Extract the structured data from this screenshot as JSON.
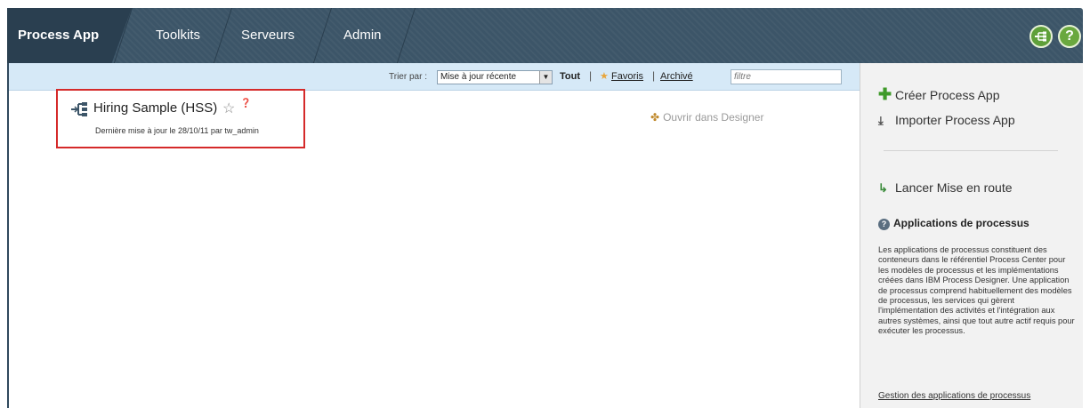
{
  "nav": {
    "tabs": [
      {
        "label": "Process App",
        "active": true
      },
      {
        "label": "Toolkits",
        "active": false
      },
      {
        "label": "Serveurs",
        "active": false
      },
      {
        "label": "Admin",
        "active": false
      }
    ],
    "icons": {
      "left": "network-icon",
      "right": "help-icon"
    },
    "help_glyph": "?"
  },
  "filterbar": {
    "sort_label": "Trier par :",
    "sort_value": "Mise à jour récente",
    "filters": {
      "all": "Tout",
      "favorites": "Favoris",
      "archived": "Archivé"
    },
    "separator": "|",
    "search_placeholder": "filtre"
  },
  "app": {
    "title": "Hiring Sample (HSS)",
    "updated": "Dernière mise à jour le 28/10/11 par tw_admin",
    "open_designer": "Ouvrir dans Designer"
  },
  "sidebar": {
    "create": "Créer Process App",
    "import": "Importer Process App",
    "launch": "Lancer Mise en route",
    "heading": "Applications de processus",
    "description": "Les applications de processus constituent des conteneurs dans le référentiel Process Center pour les modèles de processus et les implémentations créées dans IBM Process Designer. Une application de processus comprend habituellement des modèles de processus, les services qui gèrent l'implémentation des activités et l'intégration aux autres systèmes, ainsi que tout autre actif requis pour exécuter les processus.",
    "link": "Gestion des applications de processus"
  },
  "colors": {
    "nav_bg": "#3c5568",
    "nav_active": "#2a3f50",
    "filter_bg": "#d6e9f7",
    "highlight": "#d52a2a",
    "accent_green": "#5fa03a"
  }
}
